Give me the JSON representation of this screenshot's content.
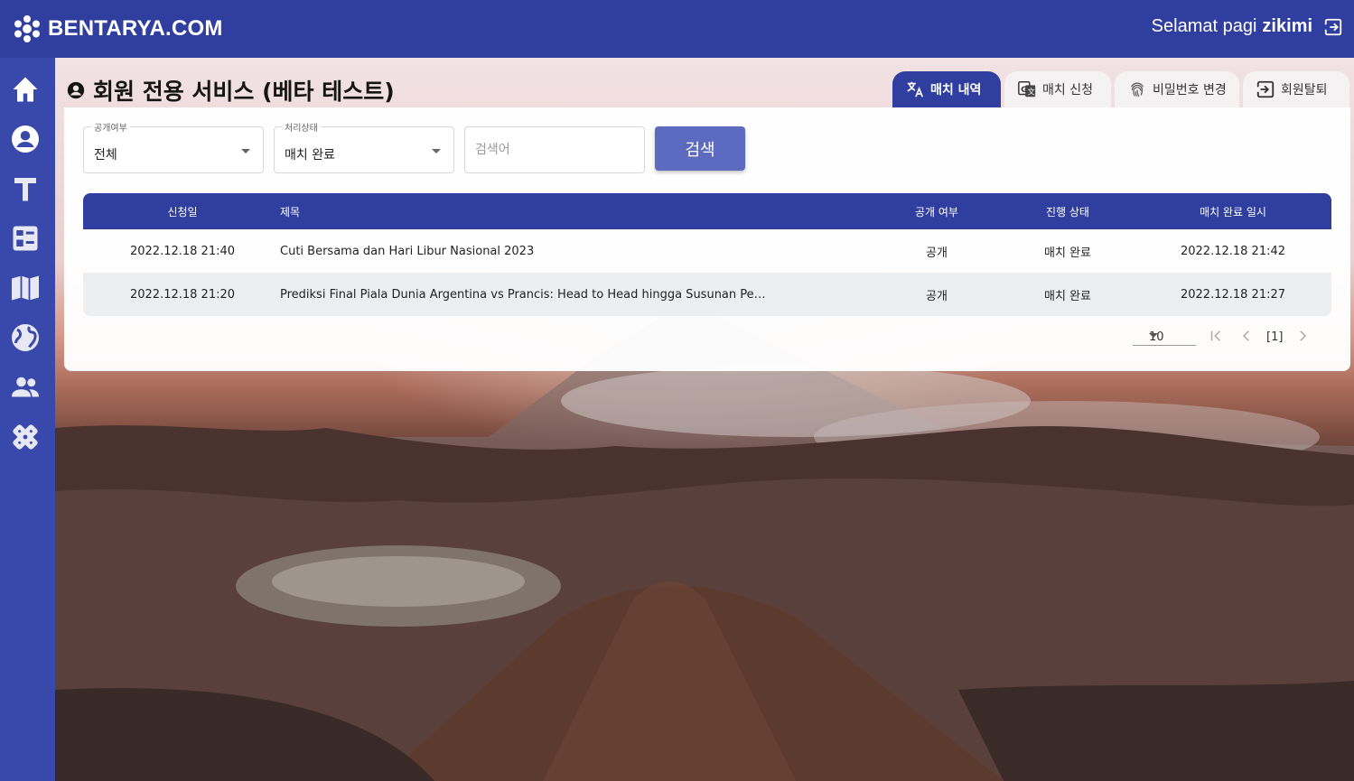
{
  "header": {
    "brand": "BENTARYA.COM",
    "greeting": "Selamat pagi",
    "username": "zikimi"
  },
  "sidebar": {
    "items": [
      {
        "icon": "home-icon"
      },
      {
        "icon": "account-icon"
      },
      {
        "icon": "text-icon"
      },
      {
        "icon": "dashboard-icon"
      },
      {
        "icon": "book-icon"
      },
      {
        "icon": "globe-icon"
      },
      {
        "icon": "people-icon"
      },
      {
        "icon": "puzzle-icon"
      }
    ]
  },
  "page": {
    "title": "회원 전용 서비스 (베타 테스트)"
  },
  "tabs": [
    {
      "label": "매치 내역",
      "active": true,
      "icon": "translate-icon"
    },
    {
      "label": "매치 신청",
      "active": false,
      "icon": "google-translate-icon"
    },
    {
      "label": "비밀번호 변경",
      "active": false,
      "icon": "fingerprint-icon"
    },
    {
      "label": "회원탈퇴",
      "active": false,
      "icon": "exit-icon"
    }
  ],
  "filters": {
    "visibility": {
      "legend": "공개여부",
      "value": "전체"
    },
    "status": {
      "legend": "처리상태",
      "value": "매치 완료"
    },
    "search": {
      "placeholder": "검색어",
      "value": ""
    },
    "search_button": "검색"
  },
  "table": {
    "columns": [
      "신청일",
      "제목",
      "공개 여부",
      "진행 상태",
      "매치 완료 일시"
    ],
    "rows": [
      [
        "2022.12.18 21:40",
        "Cuti Bersama dan Hari Libur Nasional 2023",
        "공개",
        "매치 완료",
        "2022.12.18 21:42"
      ],
      [
        "2022.12.18 21:20",
        "Prediksi Final Piala Dunia Argentina vs Prancis: Head to Head hingga Susunan Pem...",
        "공개",
        "매치 완료",
        "2022.12.18 21:27"
      ]
    ]
  },
  "pagination": {
    "page_size": "10",
    "current": "[1]"
  },
  "colors": {
    "primary": "#303f9f",
    "sidebar": "#3949ab",
    "button": "#5c6bc0"
  }
}
